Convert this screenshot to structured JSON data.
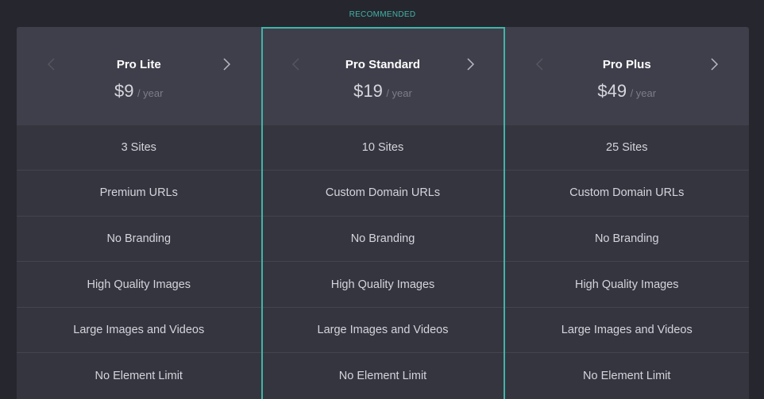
{
  "recommended_label": "RECOMMENDED",
  "plans": [
    {
      "name": "Pro Lite",
      "price": "$9",
      "period": "/ year",
      "features": [
        "3 Sites",
        "Premium URLs",
        "No Branding",
        "High Quality Images",
        "Large Images and Videos",
        "No Element Limit"
      ]
    },
    {
      "name": "Pro Standard",
      "price": "$19",
      "period": "/ year",
      "features": [
        "10 Sites",
        "Custom Domain URLs",
        "No Branding",
        "High Quality Images",
        "Large Images and Videos",
        "No Element Limit"
      ]
    },
    {
      "name": "Pro Plus",
      "price": "$49",
      "period": "/ year",
      "features": [
        "25 Sites",
        "Custom Domain URLs",
        "No Branding",
        "High Quality Images",
        "Large Images and Videos",
        "No Element Limit"
      ]
    }
  ],
  "icons": {
    "prev": "chevron-left-icon",
    "next": "chevron-right-icon"
  },
  "colors": {
    "accent": "#3fb5a8",
    "background": "#26262e",
    "header": "#3f3f4b",
    "body": "#35353f"
  }
}
